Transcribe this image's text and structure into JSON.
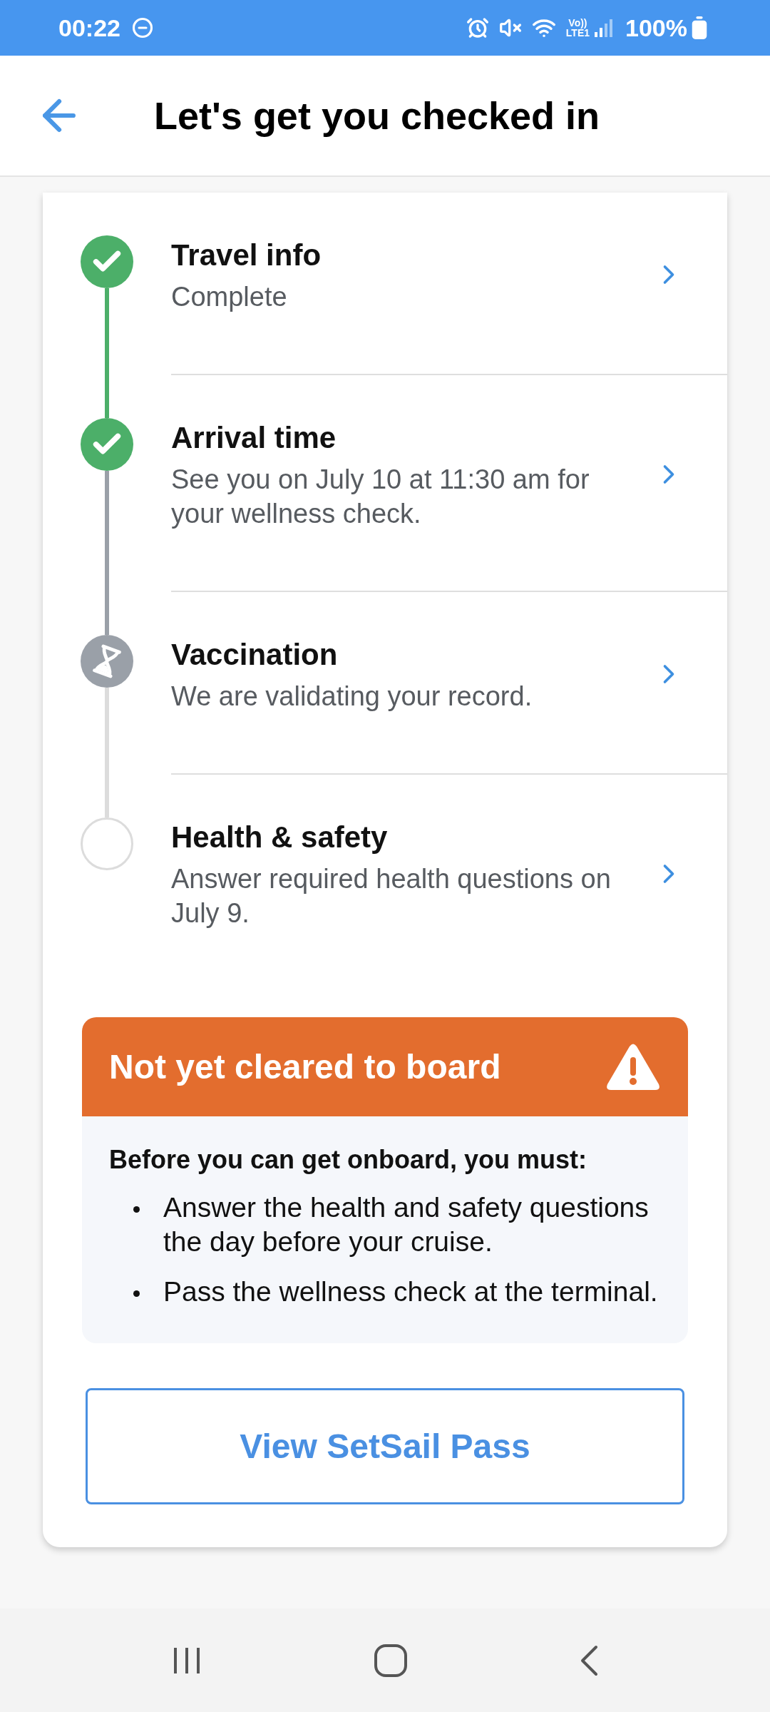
{
  "status_bar": {
    "time": "00:22",
    "volte": "Vo))",
    "network": "LTE1",
    "battery": "100%"
  },
  "header": {
    "title": "Let's get you checked in"
  },
  "steps": [
    {
      "title": "Travel info",
      "subtitle": "Complete",
      "kind": "complete"
    },
    {
      "title": "Arrival time",
      "subtitle": "See you on July 10 at 11:30 am for your wellness check.",
      "kind": "complete"
    },
    {
      "title": "Vaccination",
      "subtitle": "We are validating your record.",
      "kind": "pending"
    },
    {
      "title": "Health & safety",
      "subtitle": "Answer required health questions on July 9.",
      "kind": "todo"
    }
  ],
  "alert": {
    "title": "Not yet cleared to board",
    "intro": "Before you can get onboard, you must:",
    "items": [
      "Answer the health and safety questions the day before your cruise.",
      "Pass the wellness check at the terminal."
    ]
  },
  "button": {
    "label": "View SetSail Pass"
  }
}
